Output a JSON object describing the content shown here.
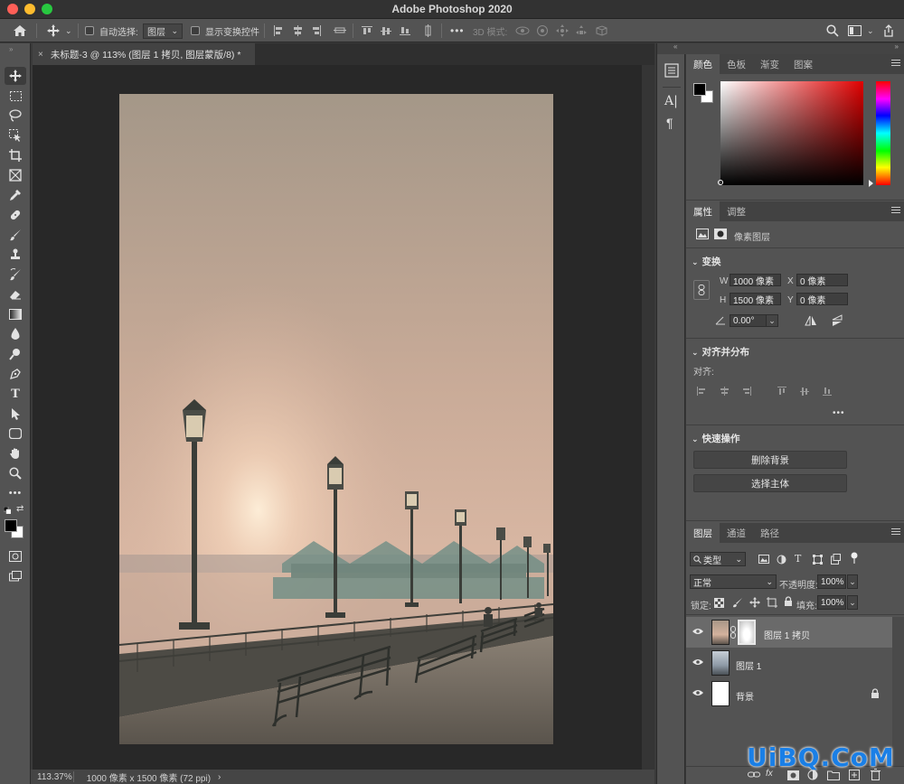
{
  "app": {
    "title": "Adobe Photoshop 2020"
  },
  "options": {
    "auto_select_label": "自动选择:",
    "auto_select_value": "图层",
    "show_transform_label": "显示变换控件",
    "mode_3d_label": "3D 模式:"
  },
  "document": {
    "tab_title": "未标题-3 @ 113% (图层 1  拷贝, 图层蒙版/8) *",
    "close_glyph": "×"
  },
  "status": {
    "zoom": "113.37%",
    "info": "1000 像素 x 1500 像素 (72 ppi)",
    "arrow": "›"
  },
  "panels": {
    "color_tabs": [
      "颜色",
      "色板",
      "渐变",
      "图案"
    ],
    "props_tabs": [
      "属性",
      "调整"
    ],
    "pixel_layer_label": "像素图层",
    "transform": {
      "title": "变换",
      "w_label": "W",
      "w_value": "1000 像素",
      "h_label": "H",
      "h_value": "1500 像素",
      "x_label": "X",
      "x_value": "0 像素",
      "y_label": "Y",
      "y_value": "0 像素",
      "angle_value": "0.00°"
    },
    "align": {
      "title": "对齐并分布",
      "label": "对齐:",
      "more": "•••"
    },
    "quick": {
      "title": "快速操作",
      "remove_bg": "删除背景",
      "select_subject": "选择主体"
    },
    "layers_tabs": [
      "图层",
      "通道",
      "路径"
    ],
    "filter_kind": "类型",
    "blend_mode": "正常",
    "opacity_label": "不透明度:",
    "opacity_value": "100%",
    "lock_label": "锁定:",
    "fill_label": "填充:",
    "fill_value": "100%",
    "layers": [
      {
        "name": "图层 1  拷贝"
      },
      {
        "name": "图层 1"
      },
      {
        "name": "背景"
      }
    ]
  },
  "watermark": "UiBQ.CoM",
  "colors": {
    "accent": "#1a7fe6",
    "panel": "#535353",
    "canvas": "#282828"
  }
}
